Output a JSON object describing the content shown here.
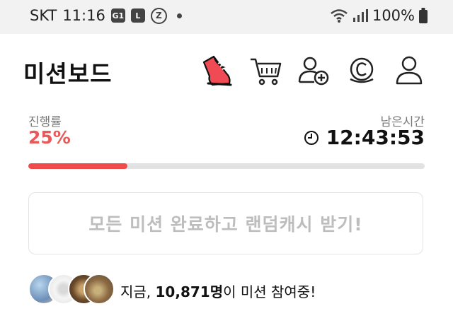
{
  "status_bar": {
    "carrier": "SKT",
    "time": "11:16",
    "badges": [
      "G1",
      "L",
      "Z"
    ],
    "battery": "100%",
    "icons": [
      "wifi-icon",
      "signal-icon",
      "battery-icon"
    ]
  },
  "header": {
    "title": "미션보드",
    "icons": [
      "sneaker-icon",
      "cart-icon",
      "add-friend-icon",
      "coin-icon",
      "profile-icon"
    ]
  },
  "progress": {
    "label": "진행률",
    "value_text": "25%",
    "fraction": 0.25
  },
  "timer": {
    "label": "남은시간",
    "value": "12:43:53"
  },
  "cta": {
    "label": "모든 미션 완료하고 랜덤캐시 받기!"
  },
  "participants": {
    "prefix": "지금, ",
    "count": "10,871명",
    "suffix": "이 미션 참여중!"
  },
  "colors": {
    "accent": "#e85a5a",
    "bar_fill": "#f04b4b",
    "bar_track": "#e2e2e2",
    "cta_text": "#bdbdbd"
  }
}
